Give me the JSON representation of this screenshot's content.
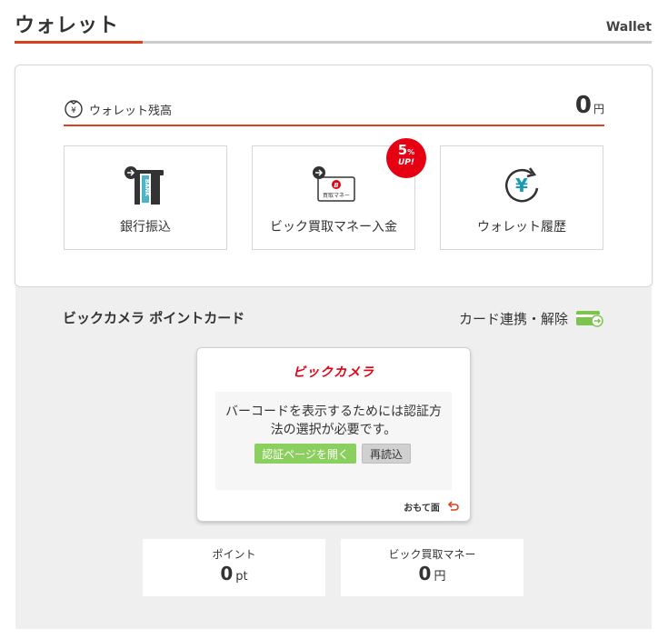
{
  "header": {
    "title": "ウォレット",
    "subtitle": "Wallet"
  },
  "wallet": {
    "balance_label": "ウォレット残高",
    "balance_value": "0",
    "balance_unit": "円",
    "actions": [
      {
        "label": "銀行振込",
        "icon": "bank-transfer-icon"
      },
      {
        "label": "ビック買取マネー入金",
        "icon": "bic-money-deposit-icon"
      },
      {
        "label": "ウォレット履歴",
        "icon": "wallet-history-icon"
      }
    ],
    "badge": {
      "main": "5",
      "pct": "%",
      "sub": "UP!"
    },
    "bank_icon_text": "BANK",
    "bic_icon_text": "買取マネー"
  },
  "pointcard": {
    "section_title": "ビックカメラ ポイントカード",
    "link_label": "カード連携・解除",
    "card_logo": "ビックカメラ",
    "message": "バーコードを表示するためには認証方法の選択が必要です。",
    "auth_button": "認証ページを開く",
    "reload_button": "再読込",
    "flip_label": "おもて面",
    "points_label": "ポイント",
    "points_value": "0",
    "points_unit": "pt",
    "money_label": "ビック買取マネー",
    "money_value": "0",
    "money_unit": "円"
  },
  "colors": {
    "accent": "#d9411e",
    "badge": "#e60012",
    "auth_button": "#8bd05e",
    "link_icon": "#7dc44e",
    "history_icon": "#1a9bb0"
  }
}
